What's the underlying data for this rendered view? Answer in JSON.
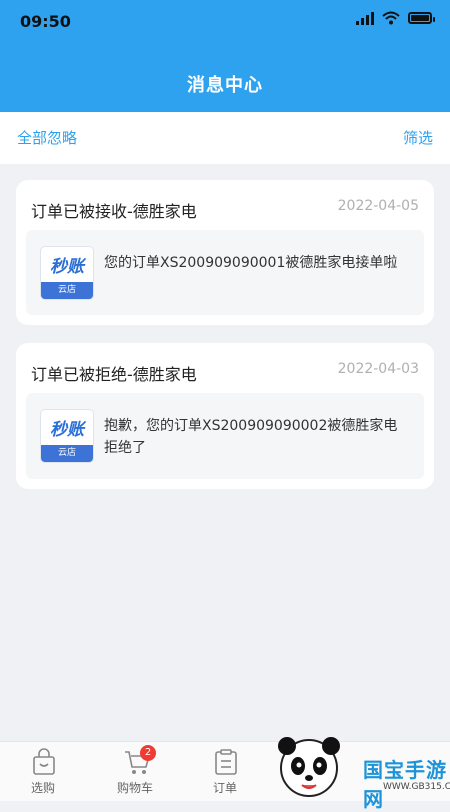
{
  "status": {
    "time": "09:50"
  },
  "header": {
    "title": "消息中心"
  },
  "actions": {
    "ignore_all": "全部忽略",
    "filter": "筛选"
  },
  "messages": [
    {
      "title": "订单已被接收-德胜家电",
      "date": "2022-04-05",
      "logo_main": "秒账",
      "logo_sub": "云店",
      "text": "您的订单XS200909090001被德胜家电接单啦"
    },
    {
      "title": "订单已被拒绝-德胜家电",
      "date": "2022-04-03",
      "logo_main": "秒账",
      "logo_sub": "云店",
      "text": "抱歉，您的订单XS200909090002被德胜家电拒绝了"
    }
  ],
  "tabbar": {
    "items": [
      {
        "label": "选购",
        "icon": "shopping-bag-icon"
      },
      {
        "label": "购物车",
        "icon": "cart-icon",
        "badge": "2"
      },
      {
        "label": "订单",
        "icon": "clipboard-icon"
      }
    ]
  },
  "watermark": {
    "text": "国宝手游网",
    "url": "WWW.GB315.COM"
  },
  "colors": {
    "primary": "#2ea2ef",
    "badge": "#ef3b34",
    "background": "#f0f1f5"
  }
}
